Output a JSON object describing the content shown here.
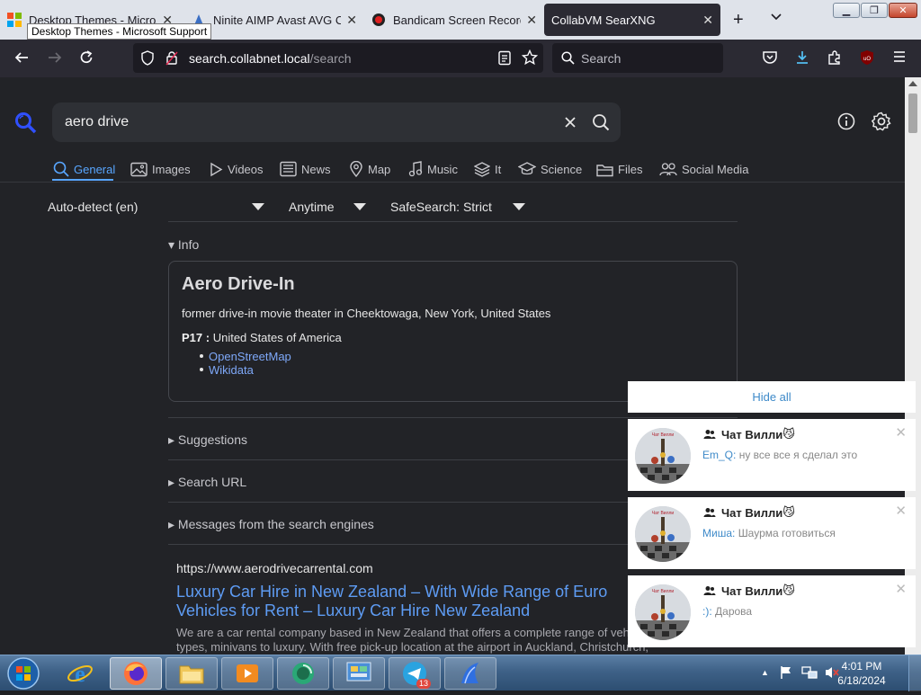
{
  "browser": {
    "tabs": [
      {
        "title": "Desktop Themes - Microsoft Support",
        "icon": "microsoft-icon",
        "active": false
      },
      {
        "title": "Ninite AIMP Avast AVG Cut",
        "icon": "ninite-icon",
        "active": false
      },
      {
        "title": "Bandicam Screen Recorder",
        "icon": "bandicam-icon",
        "active": false
      },
      {
        "title": "CollabVM SearXNG",
        "icon": "",
        "active": true
      }
    ],
    "tooltip": "Desktop Themes - Microsoft Support",
    "url": {
      "host": "search.collabnet.local",
      "path": "/search"
    },
    "search_placeholder": "Search"
  },
  "searx": {
    "query": "aero drive",
    "categories": [
      {
        "label": "General",
        "icon": "search-icon",
        "active": true
      },
      {
        "label": "Images",
        "icon": "image-icon"
      },
      {
        "label": "Videos",
        "icon": "play-icon"
      },
      {
        "label": "News",
        "icon": "newspaper-icon"
      },
      {
        "label": "Map",
        "icon": "map-pin-icon"
      },
      {
        "label": "Music",
        "icon": "music-icon"
      },
      {
        "label": "It",
        "icon": "layers-icon"
      },
      {
        "label": "Science",
        "icon": "graduation-icon"
      },
      {
        "label": "Files",
        "icon": "files-icon"
      },
      {
        "label": "Social Media",
        "icon": "people-icon"
      }
    ],
    "filters": {
      "language": "Auto-detect (en)",
      "time": "Anytime",
      "safesearch": "SafeSearch: Strict"
    },
    "infobox": {
      "section_label": "Info",
      "title": "Aero Drive-In",
      "description": "former drive-in movie theater in Cheektowaga, New York, United States",
      "attribute_key": "P17 :",
      "attribute_value": "United States of America",
      "links": [
        "OpenStreetMap",
        "Wikidata"
      ]
    },
    "collapsibles": [
      "Suggestions",
      "Search URL",
      "Messages from the search engines"
    ],
    "result": {
      "url": "https://www.aerodrivecarrental.com",
      "title_line1": "Luxury Car Hire in New Zealand – With Wide Range of Euro",
      "title_line2": "Vehicles for Rent – Luxury Car Hire New Zealand",
      "snippet": "We are a car rental company based in New Zealand that offers a complete range of veh sedan, SUV-types, minivans to luxury. With free pick-up location at the airport in Auckland, Christchurch,"
    }
  },
  "notifications": {
    "hide_all": "Hide all",
    "items": [
      {
        "chat": "Чат Вилли",
        "emoji": "😼",
        "sender": "Em_Q:",
        "message": "ну все все я сделал это"
      },
      {
        "chat": "Чат Вилли",
        "emoji": "😼",
        "sender": "Миша:",
        "message": "Шаурма готовиться"
      },
      {
        "chat": "Чат Вилли",
        "emoji": "😼",
        "sender": ":):",
        "message": "Дарова"
      }
    ]
  },
  "taskbar": {
    "time": "4:01 PM",
    "date": "6/18/2024",
    "telegram_badge": "13",
    "apps": [
      "start-orb",
      "internet-explorer-icon",
      "firefox-icon",
      "file-explorer-icon",
      "media-player-icon",
      "app-green-icon",
      "control-panel-icon",
      "telegram-icon",
      "app-blue-icon"
    ]
  },
  "colors": {
    "accent": "#58a6ff",
    "link": "#5e9cf4",
    "page_bg": "#222327",
    "toolbar": "#2b2a33"
  }
}
